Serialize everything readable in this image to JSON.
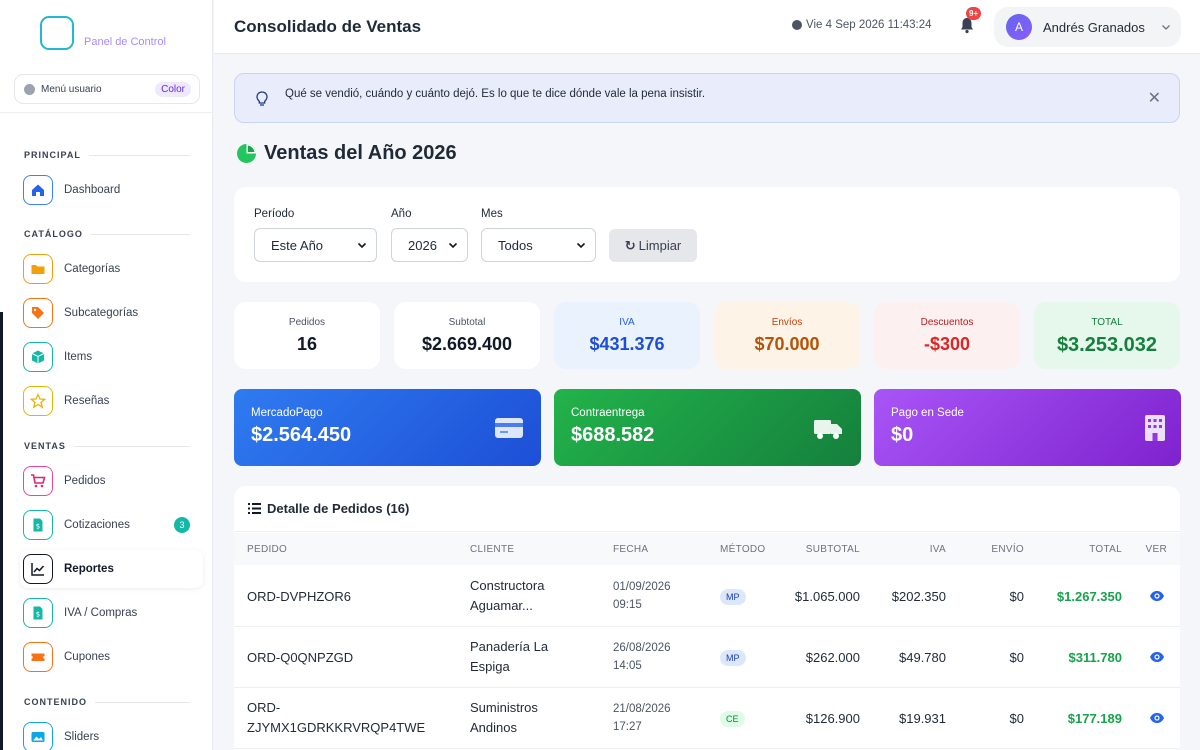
{
  "sidebar": {
    "brand": "Panel de Control",
    "user_menu": {
      "label": "Menú usuario",
      "chip": "Color"
    },
    "sections": {
      "principal": "PRINCIPAL",
      "catalogo": "CATÁLOGO",
      "ventas": "VENTAS",
      "contenido": "CONTENIDO"
    },
    "items": {
      "dashboard": "Dashboard",
      "categorias": "Categorías",
      "subcategorias": "Subcategorías",
      "items": "Items",
      "resenas": "Reseñas",
      "pedidos": "Pedidos",
      "cotizaciones": "Cotizaciones",
      "cotizaciones_badge": "3",
      "reportes": "Reportes",
      "iva_compras": "IVA / Compras",
      "cupones": "Cupones",
      "sliders": "Sliders"
    }
  },
  "header": {
    "title": "Consolidado de Ventas",
    "datetime": "Vie 4 Sep 2026 11:43:24",
    "notifications": "9+",
    "user_initial": "A",
    "user_name": "Andrés Granados"
  },
  "alert": {
    "text": "Qué se vendió, cuándo y cuánto dejó. Es lo que te dice dónde vale la pena insistir."
  },
  "page_title": "Ventas del Año 2026",
  "filters": {
    "periodo_label": "Período",
    "periodo_value": "Este Año",
    "anio_label": "Año",
    "anio_value": "2026",
    "mes_label": "Mes",
    "mes_value": "Todos",
    "clear_label": "Limpiar"
  },
  "stats": {
    "pedidos_label": "Pedidos",
    "pedidos_value": "16",
    "subtotal_label": "Subtotal",
    "subtotal_value": "$2.669.400",
    "iva_label": "IVA",
    "iva_value": "$431.376",
    "envios_label": "Envíos",
    "envios_value": "$70.000",
    "descuentos_label": "Descuentos",
    "descuentos_value": "-$300",
    "total_label": "TOTAL",
    "total_value": "$3.253.032"
  },
  "payments": {
    "mp_label": "MercadoPago",
    "mp_value": "$2.564.450",
    "ce_label": "Contraentrega",
    "ce_value": "$688.582",
    "sede_label": "Pago en Sede",
    "sede_value": "$0"
  },
  "orders": {
    "title": "Detalle de Pedidos (16)",
    "columns": {
      "pedido": "PEDIDO",
      "cliente": "CLIENTE",
      "fecha": "FECHA",
      "metodo": "MÉTODO",
      "subtotal": "SUBTOTAL",
      "iva": "IVA",
      "envio": "ENVÍO",
      "total": "TOTAL",
      "ver": "VER"
    },
    "rows": [
      {
        "pedido": "ORD-DVPHZOR6",
        "cliente_1": "Constructora",
        "cliente_2": "Aguamar...",
        "fecha_1": "01/09/2026",
        "fecha_2": "09:15",
        "metodo": "MP",
        "subtotal": "$1.065.000",
        "iva": "$202.350",
        "envio": "$0",
        "total": "$1.267.350"
      },
      {
        "pedido": "ORD-Q0QNPZGD",
        "cliente_1": "Panadería La",
        "cliente_2": "Espiga",
        "fecha_1": "26/08/2026",
        "fecha_2": "14:05",
        "metodo": "MP",
        "subtotal": "$262.000",
        "iva": "$49.780",
        "envio": "$0",
        "total": "$311.780"
      },
      {
        "pedido_1": "ORD-",
        "pedido_2": "ZJYMX1GDRKKRVRQP4TWE",
        "cliente_1": "Suministros",
        "cliente_2": "Andinos",
        "fecha_1": "21/08/2026",
        "fecha_2": "17:27",
        "metodo": "CE",
        "subtotal": "$126.900",
        "iva": "$19.931",
        "envio": "$0",
        "total": "$177.189"
      }
    ]
  },
  "colors": {
    "mercadopago": "#2563eb",
    "contraentrega": "#16a34a",
    "pago_sede": "#9333ea",
    "total_green": "#16a34a",
    "accent_teal": "#14b8a6"
  },
  "icons": {
    "logo": "logo-box",
    "clock": "clock-icon",
    "bell": "bell-icon",
    "alert": "lightbulb-icon",
    "heading": "pie-chart-icon",
    "list": "list-icon",
    "view": "eye-icon"
  }
}
